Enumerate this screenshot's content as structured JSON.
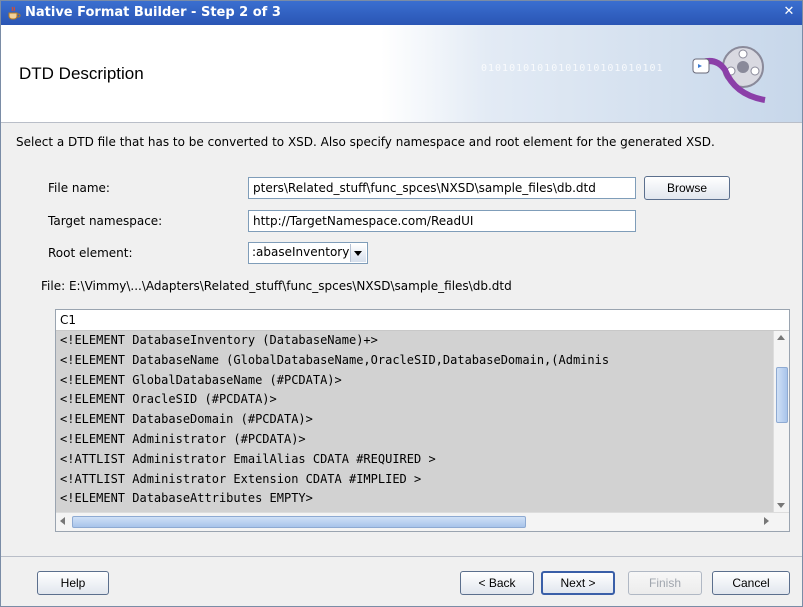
{
  "window": {
    "title": "Native Format Builder - Step 2 of 3",
    "close_glyph": "✕"
  },
  "header": {
    "title": "DTD Description",
    "banner_text": "01010101010101010101010101"
  },
  "instructions": "Select a DTD file that has to be converted to XSD. Also specify namespace and root element for the generated XSD.",
  "form": {
    "file_name_label": "File name:",
    "file_name_value": "pters\\Related_stuff\\func_spces\\NXSD\\sample_files\\db.dtd",
    "browse_label": "Browse",
    "target_namespace_label": "Target namespace:",
    "target_namespace_value": "http://TargetNamespace.com/ReadUI",
    "root_element_label": "Root element:",
    "root_element_value": ":abaseInventory",
    "file_path": "File: E:\\Vimmy\\...\\Adapters\\Related_stuff\\func_spces\\NXSD\\sample_files\\db.dtd"
  },
  "preview": {
    "column_header": "C1",
    "lines": [
      "<!ELEMENT DatabaseInventory (DatabaseName)+>",
      "<!ELEMENT DatabaseName (GlobalDatabaseName,OracleSID,DatabaseDomain,(Adminis",
      "<!ELEMENT GlobalDatabaseName (#PCDATA)>",
      "<!ELEMENT OracleSID (#PCDATA)>",
      "<!ELEMENT DatabaseDomain (#PCDATA)>",
      "<!ELEMENT Administrator (#PCDATA)>",
      "<!ATTLIST Administrator EmailAlias CDATA #REQUIRED >",
      "<!ATTLIST Administrator Extension CDATA #IMPLIED >",
      "<!ELEMENT DatabaseAttributes EMPTY>"
    ]
  },
  "footer": {
    "help_label": "Help",
    "back_label": "< Back",
    "next_label": "Next >",
    "finish_label": "Finish",
    "cancel_label": "Cancel"
  },
  "icons": {
    "app": "java-cup-icon",
    "logo": "film-reel-logo"
  },
  "colors": {
    "titlebar": "#2a55b4",
    "text_area_bg": "#d2d2d2"
  }
}
